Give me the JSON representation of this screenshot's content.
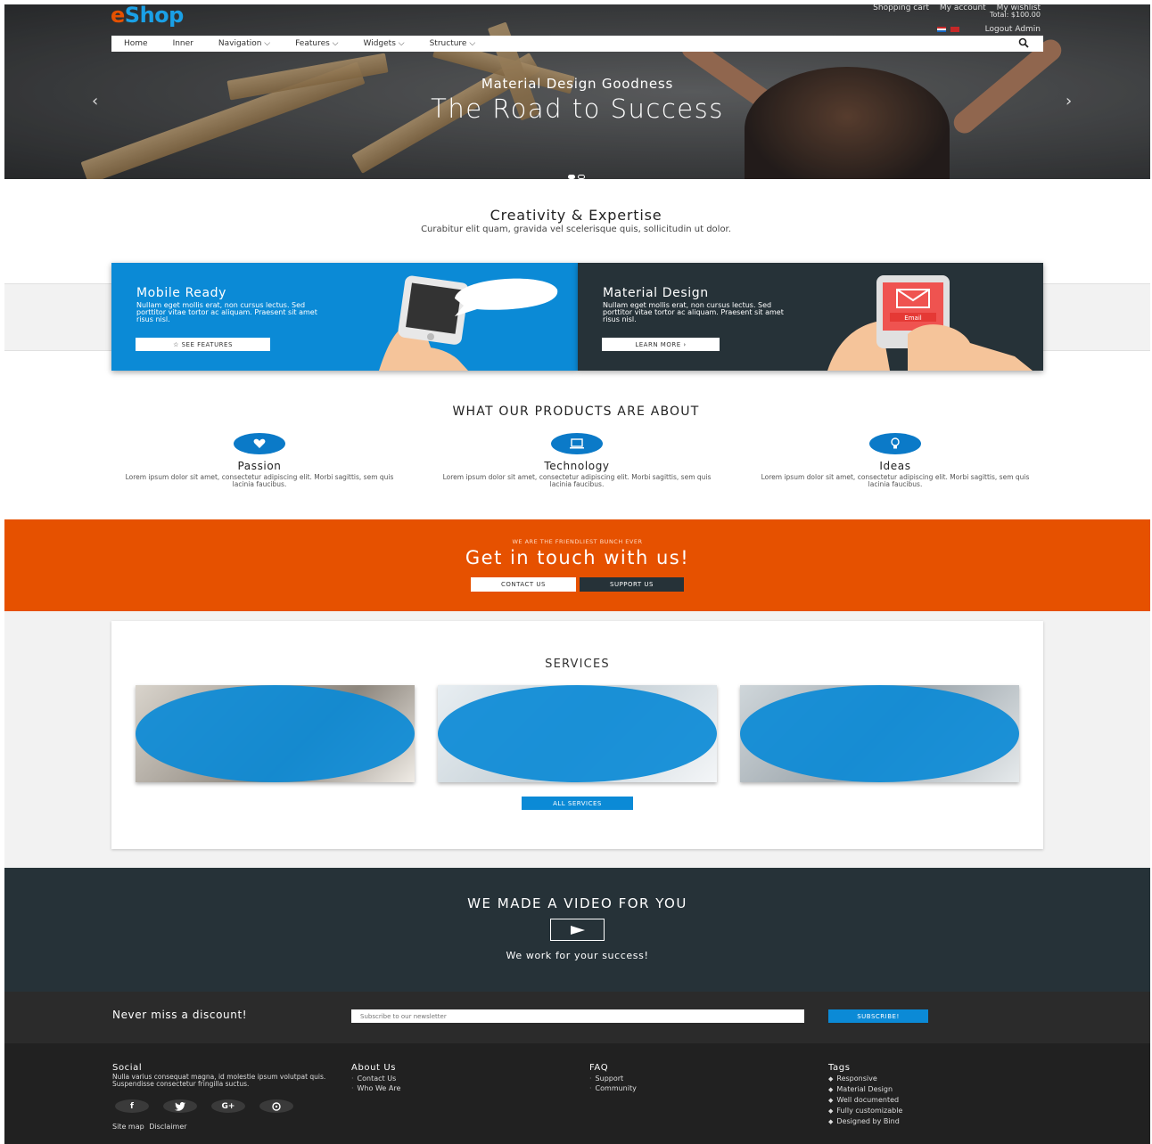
{
  "brand": {
    "logo_e": "e",
    "logo_rest": "Shop",
    "accent": "#1aa0e6",
    "orange": "#e65100",
    "dark": "#263238"
  },
  "topbar": {
    "shopping_cart": "Shopping cart",
    "my_account": "My account",
    "my_wishlist": "My wishlist",
    "total": "Total:  $100.00",
    "logout": "Logout Admin"
  },
  "nav": {
    "items": [
      "Home",
      "Inner",
      "Navigation ⌵",
      "Features ⌵",
      "Widgets ⌵",
      "Structure ⌵"
    ],
    "search_icon": "search-icon"
  },
  "hero": {
    "subtitle": "Material Design Goodness",
    "title": "The Road to Success",
    "prev": "‹",
    "next": "›"
  },
  "creativity": {
    "title": "Creativity & Expertise",
    "subtitle": "Curabitur elit quam, gravida vel scelerisque quis, sollicitudin ut dolor."
  },
  "features": {
    "mobile": {
      "title": "Mobile Ready",
      "text": "Nullam eget mollis erat, non cursus lectus. Sed porttitor vitae tortor ac aliquam. Praesent sit amet risus nisl.",
      "button": "☆  SEE FEATURES"
    },
    "material": {
      "title": "Material Design",
      "text": "Nullam eget mollis erat, non cursus lectus. Sed porttitor vitae tortor ac aliquam. Praesent sit amet risus nisl.",
      "button": "LEARN MORE  ›",
      "email_label": "Email"
    }
  },
  "products": {
    "title": "WHAT OUR PRODUCTS ARE ABOUT",
    "items": [
      {
        "name": "Passion",
        "icon": "heart-icon",
        "text": "Lorem ipsum dolor sit amet, consectetur adipiscing elit. Morbi sagittis, sem quis lacinia faucibus."
      },
      {
        "name": "Technology",
        "icon": "laptop-icon",
        "text": "Lorem ipsum dolor sit amet, consectetur adipiscing elit. Morbi sagittis, sem quis lacinia faucibus."
      },
      {
        "name": "Ideas",
        "icon": "lightbulb-icon",
        "text": "Lorem ipsum dolor sit amet, consectetur adipiscing elit. Morbi sagittis, sem quis lacinia faucibus."
      }
    ]
  },
  "contact": {
    "small": "WE ARE THE FRIENDLIEST BUNCH EVER",
    "title": "Get in touch with us!",
    "contact_button": "CONTACT US",
    "support_button": "SUPPORT US"
  },
  "services": {
    "title": "SERVICES",
    "button": "ALL SERVICES"
  },
  "video": {
    "title": "WE MADE A VIDEO FOR YOU",
    "subtitle": "We work for your success!"
  },
  "newsletter": {
    "title": "Never miss a discount!",
    "placeholder": "Subscribe to our newsletter",
    "button": "SUBSCRIBE!"
  },
  "footer": {
    "social": {
      "title": "Social",
      "text": "Nulla varius consequat magna, id molestie ipsum volutpat quis. Suspendisse consectetur fringilla suctus.",
      "icons": [
        "f",
        "t",
        "G+",
        "p"
      ]
    },
    "about": {
      "title": "About Us",
      "links": [
        "Contact Us",
        "Who We Are"
      ]
    },
    "faq": {
      "title": "FAQ",
      "links": [
        "Support",
        "Community"
      ]
    },
    "tags": {
      "title": "Tags",
      "items": [
        "Responsive",
        "Material Design",
        "Well documented",
        "Fully customizable",
        "Designed by Bind"
      ]
    },
    "bottom_links": [
      "Site map",
      "Disclaimer"
    ]
  }
}
